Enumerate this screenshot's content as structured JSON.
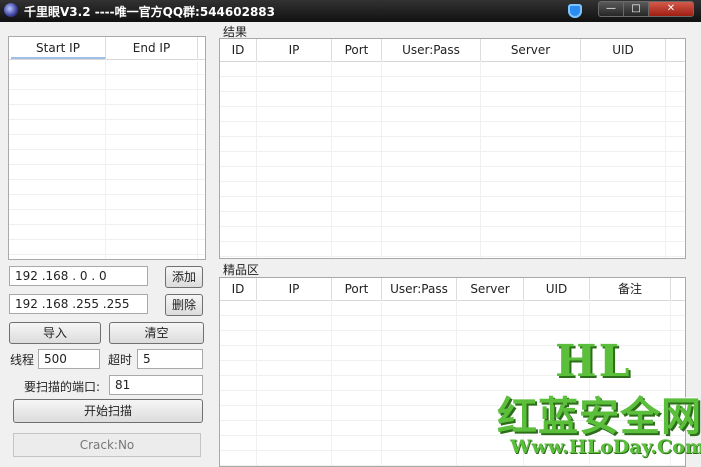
{
  "window": {
    "title": "千里眼V3.2 ----唯一官方QQ群:544602883"
  },
  "ip_range": {
    "headers": [
      "Start IP",
      "End IP"
    ]
  },
  "results": {
    "group_label": "结果",
    "columns": [
      "ID",
      "IP",
      "Port",
      "User:Pass",
      "Server",
      "UID"
    ]
  },
  "favorites": {
    "group_label": "精品区",
    "columns": [
      "ID",
      "IP",
      "Port",
      "User:Pass",
      "Server",
      "UID",
      "备注"
    ]
  },
  "controls": {
    "start_ip": "192 .168 . 0 . 0",
    "end_ip": "192 .168 .255 .255",
    "add": "添加",
    "delete": "删除",
    "import": "导入",
    "clear": "清空",
    "threads_label": "线程",
    "threads_value": "500",
    "timeout_label": "超时",
    "timeout_value": "5",
    "ports_label": "要扫描的端口:",
    "ports_value": "81",
    "start_scan": "开始扫描",
    "status": "Crack:No"
  },
  "watermark": {
    "brand": "HL",
    "name": "红蓝安全网",
    "url": "Www.HLoDay.Com"
  }
}
